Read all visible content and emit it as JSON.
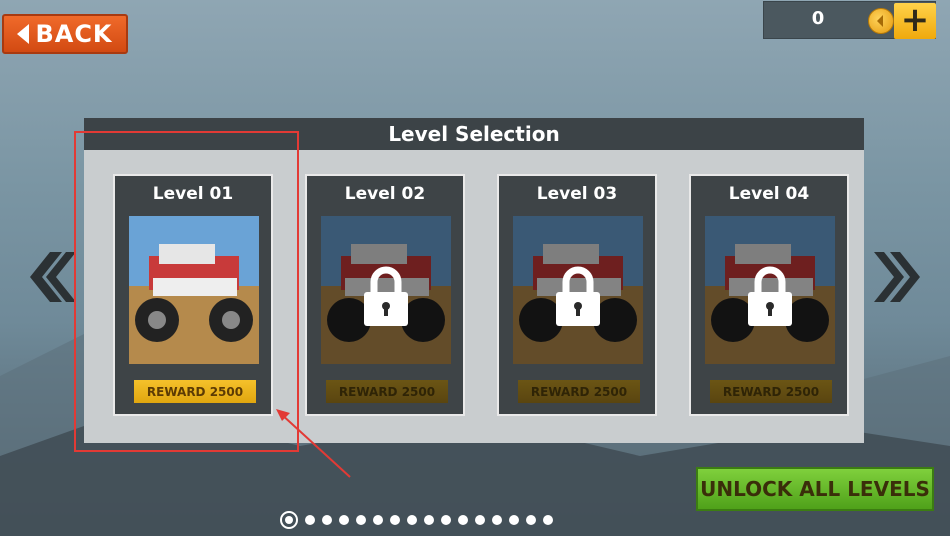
{
  "header": {
    "back_label": "BACK",
    "coins": "0"
  },
  "panel": {
    "title": "Level Selection"
  },
  "levels": [
    {
      "title": "Level 01",
      "reward": "REWARD 2500",
      "locked": false
    },
    {
      "title": "Level 02",
      "reward": "REWARD 2500",
      "locked": true
    },
    {
      "title": "Level 03",
      "reward": "REWARD 2500",
      "locked": true
    },
    {
      "title": "Level 04",
      "reward": "REWARD 2500",
      "locked": true
    }
  ],
  "footer": {
    "unlock_label": "UNLOCK ALL LEVELS",
    "page_count": 16,
    "current_page": 1
  },
  "colors": {
    "accent_orange": "#e0561b",
    "reward_gold": "#f0b51c",
    "unlock_green": "#5cb524",
    "highlight_red": "#e23a35"
  }
}
